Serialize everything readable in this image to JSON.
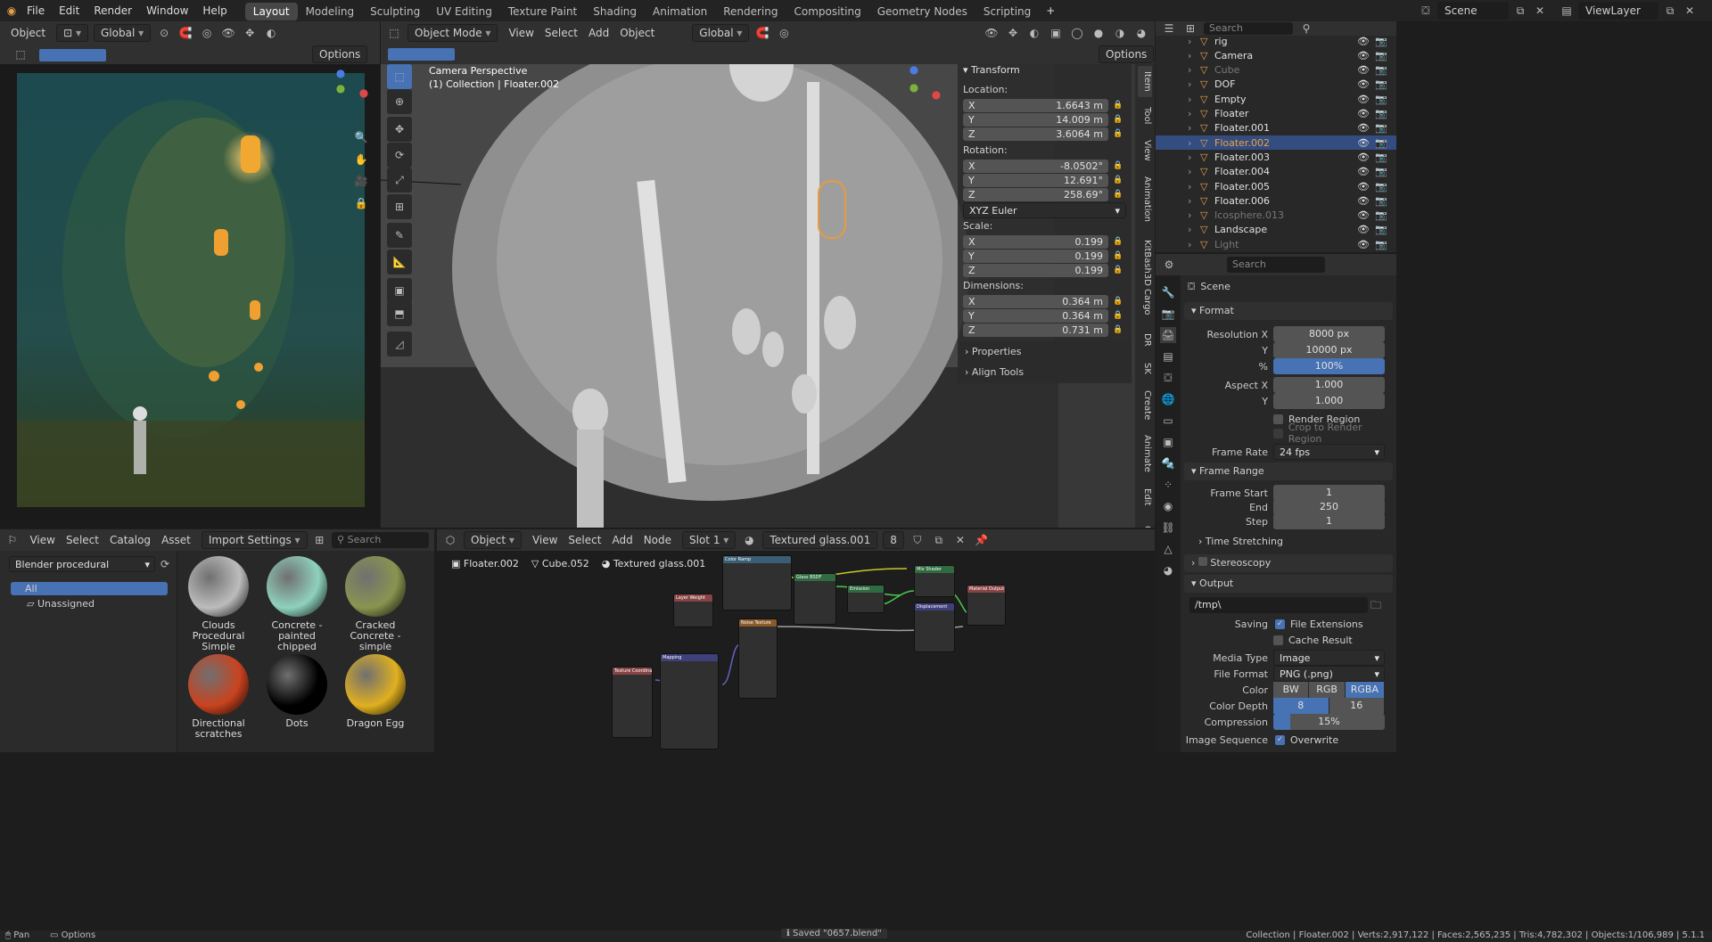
{
  "topbar": {
    "menus": [
      "File",
      "Edit",
      "Render",
      "Window",
      "Help"
    ],
    "workspaces": [
      "Layout",
      "Modeling",
      "Sculpting",
      "UV Editing",
      "Texture Paint",
      "Shading",
      "Animation",
      "Rendering",
      "Compositing",
      "Geometry Nodes",
      "Scripting"
    ],
    "active_workspace": "Layout",
    "scene": "Scene",
    "view_layer": "ViewLayer",
    "add_tab": "+"
  },
  "left_view": {
    "mode": "Object",
    "orientation": "Global",
    "options": "Options"
  },
  "viewport": {
    "mode": "Object Mode",
    "menus": [
      "View",
      "Select",
      "Add",
      "Object"
    ],
    "orientation": "Global",
    "options": "Options",
    "camera_label": "Camera Perspective",
    "collection_label": "(1) Collection | Floater.002",
    "tabs": [
      "Item",
      "Tool",
      "View",
      "Animation",
      "KitBash3D Cargo",
      "DR",
      "SK",
      "Create",
      "Animate",
      "Edit",
      "Grease Pencil"
    ],
    "transform": {
      "title": "Transform",
      "location": "Location:",
      "rotation": "Rotation:",
      "scale": "Scale:",
      "dimensions": "Dimensions:",
      "loc": [
        "1.6643 m",
        "14.009 m",
        "3.6064 m"
      ],
      "rot": [
        "-8.0502°",
        "12.691°",
        "258.69°"
      ],
      "rot_mode": "XYZ Euler",
      "scl": [
        "0.199",
        "0.199",
        "0.199"
      ],
      "dim": [
        "0.364 m",
        "0.364 m",
        "0.731 m"
      ],
      "axes": [
        "X",
        "Y",
        "Z"
      ]
    },
    "properties": "Properties",
    "align_tools": "Align Tools"
  },
  "outliner": {
    "search_placeholder": "Search",
    "items": [
      {
        "name": "rig",
        "dim": false
      },
      {
        "name": "Camera",
        "dim": false
      },
      {
        "name": "Cube",
        "dim": true
      },
      {
        "name": "DOF",
        "dim": false
      },
      {
        "name": "Empty",
        "dim": false
      },
      {
        "name": "Floater",
        "dim": false
      },
      {
        "name": "Floater.001",
        "dim": false
      },
      {
        "name": "Floater.002",
        "dim": false,
        "selected": true
      },
      {
        "name": "Floater.003",
        "dim": false
      },
      {
        "name": "Floater.004",
        "dim": false
      },
      {
        "name": "Floater.005",
        "dim": false
      },
      {
        "name": "Floater.006",
        "dim": false
      },
      {
        "name": "Icosphere.013",
        "dim": true
      },
      {
        "name": "Landscape",
        "dim": false
      },
      {
        "name": "Light",
        "dim": true
      }
    ]
  },
  "properties": {
    "search_placeholder": "Search",
    "scene": "Scene",
    "format": {
      "title": "Format",
      "res_x_label": "Resolution X",
      "res_x": "8000 px",
      "y_label": "Y",
      "res_y": "10000 px",
      "pct_label": "%",
      "pct": "100%",
      "aspect_x_label": "Aspect X",
      "aspect_x": "1.000",
      "aspect_y": "1.000",
      "render_region": "Render Region",
      "crop": "Crop to Render Region",
      "frame_rate_label": "Frame Rate",
      "frame_rate": "24 fps"
    },
    "frame_range": {
      "title": "Frame Range",
      "start_label": "Frame Start",
      "start": "1",
      "end_label": "End",
      "end": "250",
      "step_label": "Step",
      "step": "1",
      "time_stretching": "Time Stretching"
    },
    "stereoscopy": "Stereoscopy",
    "output": {
      "title": "Output",
      "path": "/tmp\\",
      "saving_label": "Saving",
      "file_ext": "File Extensions",
      "cache": "Cache Result",
      "media_type_label": "Media Type",
      "media_type": "Image",
      "file_format_label": "File Format",
      "file_format": "PNG (.png)",
      "color_label": "Color",
      "color_opts": [
        "BW",
        "RGB",
        "RGBA"
      ],
      "depth_label": "Color Depth",
      "depth_opts": [
        "8",
        "16"
      ],
      "compression_label": "Compression",
      "compression": "15%",
      "compression_value": 0.15,
      "seq_label": "Image Sequence",
      "overwrite": "Overwrite"
    }
  },
  "assets": {
    "menus": [
      "View",
      "Select",
      "Catalog",
      "Asset"
    ],
    "import": "Import Settings",
    "search_placeholder": "Search",
    "library": "Blender procedural",
    "catalogs": [
      "All",
      "Unassigned"
    ],
    "items": [
      {
        "name": "Clouds Procedural Simple",
        "color": "#bcbcbc"
      },
      {
        "name": "Concrete - painted chipped",
        "color": "#8fd1bd"
      },
      {
        "name": "Cracked Concrete - simple",
        "color": "#8a9450"
      },
      {
        "name": "Directional scratches",
        "color": "#c9431f"
      },
      {
        "name": "Dots",
        "color": "#000000"
      },
      {
        "name": "Dragon Egg",
        "color": "#e0b020"
      }
    ]
  },
  "nodes": {
    "object": "Object",
    "menus": [
      "View",
      "Select",
      "Add",
      "Node"
    ],
    "slot": "Slot 1",
    "material": "Textured glass.001",
    "users": "8",
    "breadcrumb": [
      "Floater.002",
      "Cube.052",
      "Textured glass.001"
    ],
    "node_titles": [
      "Layer Weight",
      "Color Ramp",
      "Glass BSDF",
      "Emission",
      "Mix Shader",
      "Material Output",
      "Noise Texture",
      "Displacement",
      "Texture Coordinate",
      "Mapping"
    ]
  },
  "status": {
    "pan": "Pan",
    "options": "Options",
    "saved": "Saved \"0657.blend\"",
    "stats": "Collection | Floater.002 | Verts:2,917,122 | Faces:2,565,235 | Tris:4,782,302 | Objects:1/106,989 | 5.1.1"
  },
  "colors": {
    "accent": "#4772b3",
    "selected_outline": "#e89b3a",
    "orange": "#e8a14a"
  }
}
